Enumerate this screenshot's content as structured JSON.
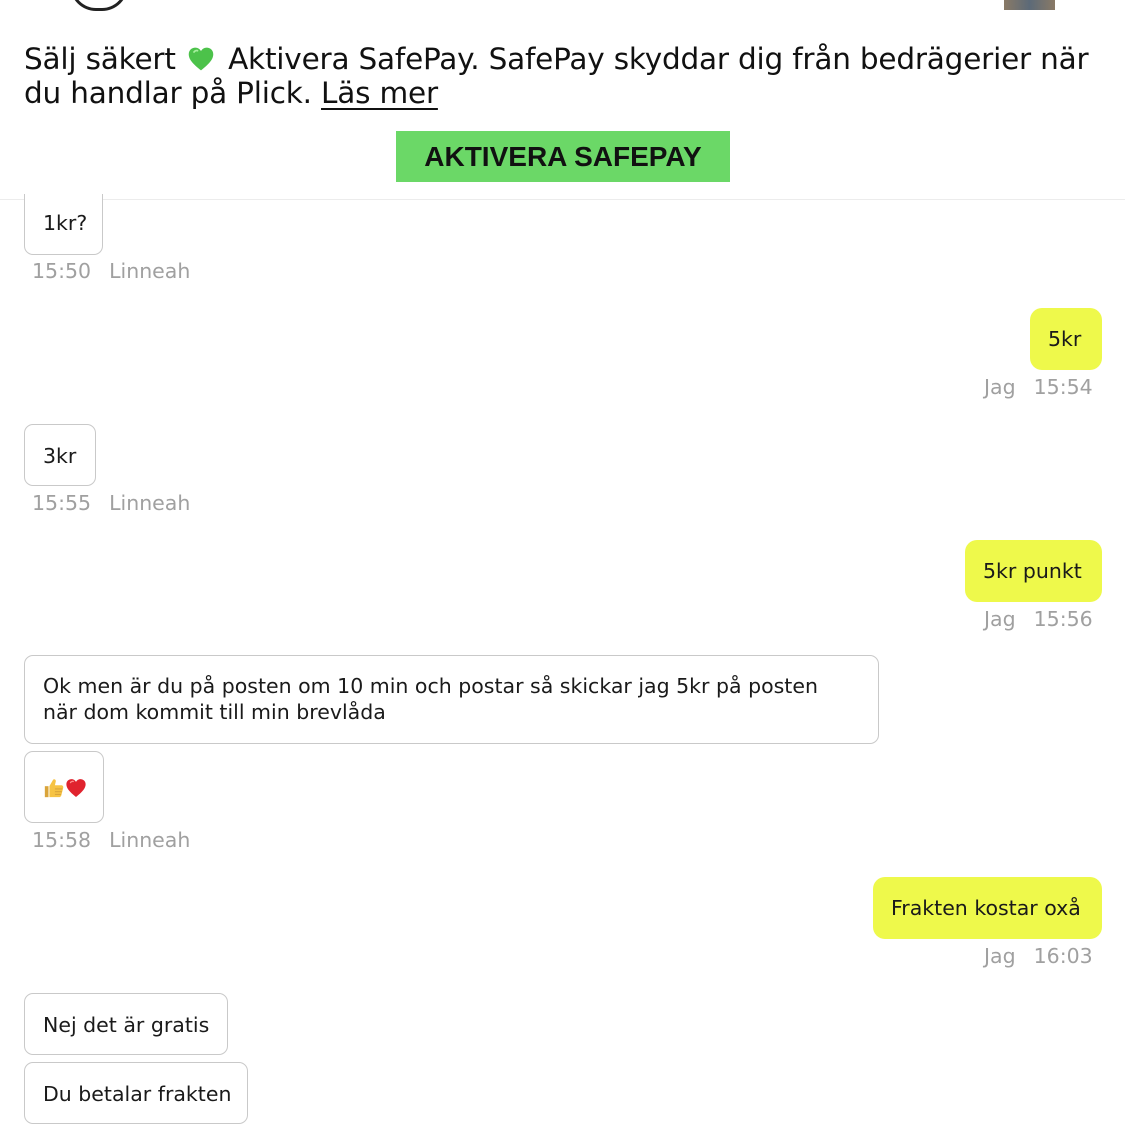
{
  "banner": {
    "text_before": "Sälj säkert",
    "heart_emoji": "green-heart",
    "text_after": "Aktivera SafePay. SafePay skyddar dig från bedrägerier när du handlar på Plick.",
    "link": "Läs mer",
    "button": "AKTIVERA SAFEPAY"
  },
  "colors": {
    "incoming_border": "#c9c9c9",
    "outgoing_bg": "#eef94b",
    "button_bg": "#6bd867",
    "meta_text": "#a0a0a0"
  },
  "messages": [
    {
      "text": "1kr?",
      "time": "15:50",
      "sender": "Linneah"
    },
    {
      "text": "5kr",
      "time": "15:54",
      "sender": "Jag"
    },
    {
      "text": "3kr",
      "time": "15:55",
      "sender": "Linneah"
    },
    {
      "text": "5kr punkt",
      "time": "15:56",
      "sender": "Jag"
    },
    {
      "text": "Ok men är du på posten om 10 min och postar så skickar jag 5kr på posten när dom kommit till min brevlåda"
    },
    {
      "emoji": [
        "thumbs-up",
        "red-heart"
      ],
      "time": "15:58",
      "sender": "Linneah"
    },
    {
      "text": "Frakten kostar oxå",
      "time": "16:03",
      "sender": "Jag"
    },
    {
      "text": "Nej det är gratis"
    },
    {
      "text": "Du betalar frakten"
    }
  ]
}
